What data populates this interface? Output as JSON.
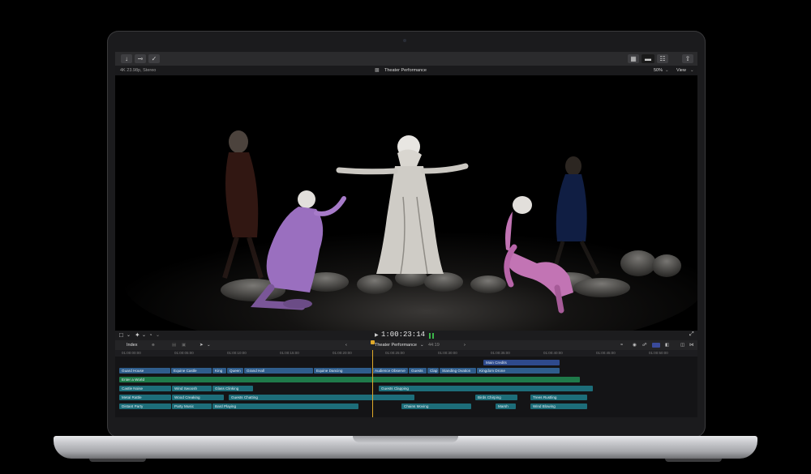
{
  "toolbar": {
    "left_icons": [
      "import-icon",
      "keyword-icon",
      "checkmark-icon"
    ],
    "right_icons": [
      "browser-layout-icon",
      "timeline-layout-icon",
      "inspector-layout-icon",
      "share-icon"
    ]
  },
  "viewer": {
    "format": "4K 23.98p, Stereo",
    "title": "Theater Performance",
    "zoom": "50%",
    "view_label": "View"
  },
  "transport": {
    "timecode": "1:00:23:14"
  },
  "timeline": {
    "index_label": "Index",
    "project_name": "Theater Performance",
    "duration": "44:19",
    "ruler_ticks": [
      "01:00:00:00",
      "01:00:05:00",
      "01:00:10:00",
      "01:00:15:00",
      "01:00:20:00",
      "01:00:25:00",
      "01:00:30:00",
      "01:00:35:00",
      "01:00:40:00",
      "01:00:45:00",
      "01:00:50:00",
      "01:00:55:00"
    ],
    "title_clips": [
      {
        "label": "Main Credits"
      }
    ],
    "video_clips": [
      {
        "label": "Guard House"
      },
      {
        "label": "Equine Castle"
      },
      {
        "label": "King"
      },
      {
        "label": "Queen"
      },
      {
        "label": "Grand Hall"
      },
      {
        "label": "Equine Dancing"
      },
      {
        "label": "Audience Observe"
      },
      {
        "label": "Guests"
      },
      {
        "label": "Clap"
      },
      {
        "label": "Standing Ovation"
      },
      {
        "label": "Kingdom Drone"
      }
    ],
    "storyline": {
      "label": "Enter a World"
    },
    "audio_rows": [
      [
        {
          "label": "Castle Noise"
        },
        {
          "label": "Wind Swoosh"
        },
        {
          "label": "Glass Clinking"
        },
        {
          "label": "Guests Clapping"
        }
      ],
      [
        {
          "label": "Metal Rattle"
        },
        {
          "label": "Wood Creaking"
        },
        {
          "label": "Guests Chatting"
        },
        {
          "label": "Birds Chirping"
        },
        {
          "label": "Trees Rustling"
        }
      ],
      [
        {
          "label": "Distant Party"
        },
        {
          "label": "Party Music"
        },
        {
          "label": "Bard Playing"
        },
        {
          "label": "Chains Moving"
        },
        {
          "label": "Marsh"
        },
        {
          "label": "Wind Blowing"
        }
      ]
    ]
  }
}
